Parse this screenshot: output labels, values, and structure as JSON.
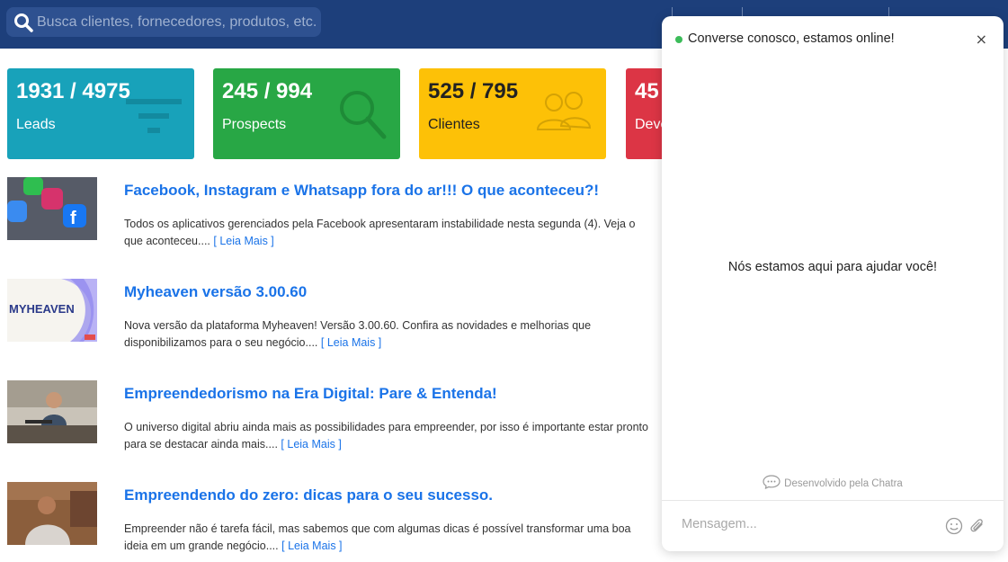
{
  "search": {
    "placeholder": "Busca clientes, fornecedores, produtos, etc..."
  },
  "stats": [
    {
      "value": "1931 / 4975",
      "label": "Leads"
    },
    {
      "value": "245 / 994",
      "label": "Prospects"
    },
    {
      "value": "525 / 795",
      "label": "Clientes"
    },
    {
      "value": "45",
      "label": "Deve"
    }
  ],
  "news": [
    {
      "title": "Facebook, Instagram e Whatsapp fora do ar!!! O que aconteceu?!",
      "excerpt": "Todos os aplicativos gerenciados pela Facebook apresentaram instabilidade nesta segunda (4). Veja o que aconteceu....",
      "more": "[ Leia Mais ]"
    },
    {
      "title": "Myheaven versão 3.00.60",
      "excerpt": "Nova versão da plataforma Myheaven! Versão 3.00.60. Confira as novidades e melhorias que disponibilizamos para o seu negócio....",
      "more": "[ Leia Mais ]",
      "thumb_text": "MYHEAVEN"
    },
    {
      "title": "Empreendedorismo na Era Digital: Pare & Entenda!",
      "excerpt": "O universo digital abriu ainda mais as possibilidades para empreender, por isso é importante estar pronto para se destacar ainda mais....",
      "more": "[ Leia Mais ]"
    },
    {
      "title": "Empreendendo do zero: dicas para o seu sucesso.",
      "excerpt": "Empreender não é tarefa fácil, mas sabemos que com algumas dicas é possível transformar uma boa ideia em um grande negócio....",
      "more": "[ Leia Mais ]"
    }
  ],
  "chat": {
    "header": "Converse conosco, estamos online!",
    "close": "×",
    "center": "Nós estamos aqui para ajudar você!",
    "powered": "Desenvolvido pela Chatra",
    "placeholder": "Mensagem..."
  },
  "colors": {
    "topbar": "#1d3f7b",
    "leads": "#18a2ba",
    "prospects": "#28a745",
    "clientes": "#fdc107",
    "dev": "#dc3545",
    "link": "#1a73e8"
  }
}
